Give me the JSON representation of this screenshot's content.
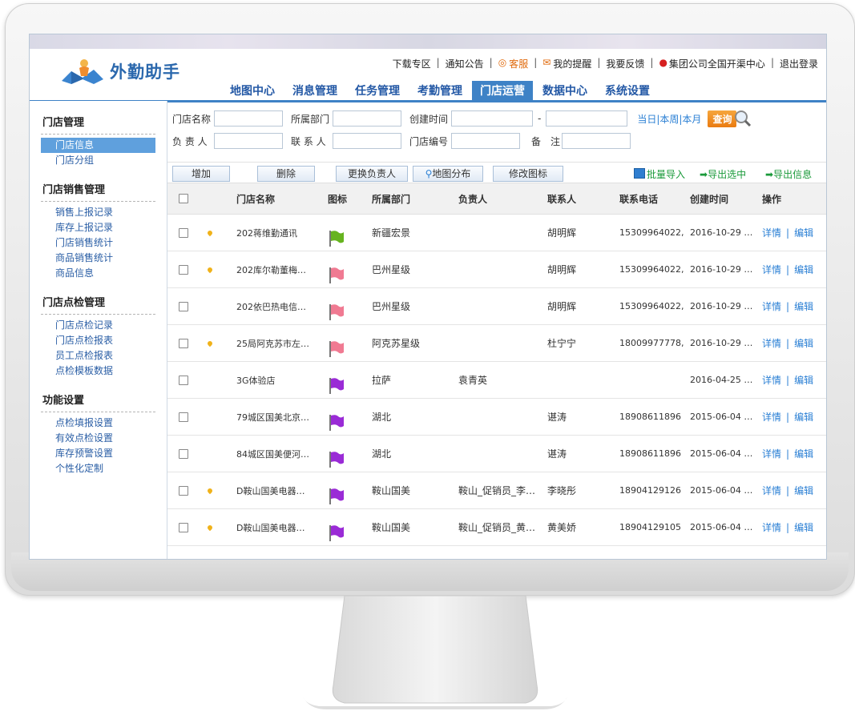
{
  "header": {
    "logo_text": "外勤助手",
    "top_links": [
      "下载专区",
      "通知公告",
      "客服",
      "我的提醒",
      "我要反馈",
      "集团公司全国开渠中心",
      "退出登录"
    ],
    "nav": [
      "地图中心",
      "消息管理",
      "任务管理",
      "考勤管理",
      "门店运营",
      "数据中心",
      "系统设置"
    ],
    "active_nav": "门店运营"
  },
  "sidebar": {
    "groups": [
      {
        "title": "门店管理",
        "items": [
          "门店信息",
          "门店分组"
        ]
      },
      {
        "title": "门店销售管理",
        "items": [
          "销售上报记录",
          "库存上报记录",
          "门店销售统计",
          "商品销售统计",
          "商品信息"
        ]
      },
      {
        "title": "门店点检管理",
        "items": [
          "门店点检记录",
          "门店点检报表",
          "员工点检报表",
          "点检模板数据"
        ]
      },
      {
        "title": "功能设置",
        "items": [
          "点检填报设置",
          "有效点检设置",
          "库存预警设置",
          "个性化定制"
        ]
      }
    ],
    "active_item": "门店信息"
  },
  "filters": {
    "store_name_label": "门店名称",
    "dept_label": "所属部门",
    "created_label": "创建时间",
    "dash": "-",
    "quick_range": "当日|本周|本月",
    "query_btn": "查询",
    "owner_label": "负 责 人",
    "contact_label": "联 系 人",
    "store_no_label": "门店编号",
    "remark_label": "备　注"
  },
  "toolbar": {
    "add": "增加",
    "delete": "删除",
    "change_owner": "更换负责人",
    "map_dist": "地图分布",
    "edit_icon": "修改图标",
    "batch_import": "批量导入",
    "export_selected": "导出选中",
    "export_info": "导出信息"
  },
  "table": {
    "headers": [
      "门店名称",
      "图标",
      "所属部门",
      "负责人",
      "联系人",
      "联系电话",
      "创建时间",
      "操作"
    ],
    "detail": "详情",
    "edit": "编辑",
    "rows": [
      {
        "pin": true,
        "name": "202蒋维勤通讯",
        "flag": "#66b31f",
        "dept": "新疆宏景",
        "owner": "",
        "contact": "胡明辉",
        "phone": "15309964022,",
        "created": "2016-10-29 …"
      },
      {
        "pin": true,
        "name": "202库尔勒董梅…",
        "flag": "#f07a92",
        "dept": "巴州星级",
        "owner": "",
        "contact": "胡明辉",
        "phone": "15309964022,",
        "created": "2016-10-29 …"
      },
      {
        "pin": false,
        "name": "202依巴热电信…",
        "flag": "#f07a92",
        "dept": "巴州星级",
        "owner": "",
        "contact": "胡明辉",
        "phone": "15309964022,",
        "created": "2016-10-29 …"
      },
      {
        "pin": true,
        "name": "25局阿克苏市左…",
        "flag": "#f07a92",
        "dept": "阿克苏星级",
        "owner": "",
        "contact": "杜宁宁",
        "phone": "18009977778,",
        "created": "2016-10-29 …"
      },
      {
        "pin": false,
        "name": "3G体验店",
        "flag": "#9a2bd6",
        "dept": "拉萨",
        "owner": "袁青英",
        "contact": "",
        "phone": "",
        "created": "2016-04-25 …"
      },
      {
        "pin": false,
        "name": "79城区国美北京…",
        "flag": "#9a2bd6",
        "dept": "湖北",
        "owner": "",
        "contact": "谌涛",
        "phone": "18908611896",
        "created": "2015-06-04 …"
      },
      {
        "pin": false,
        "name": "84城区国美便河…",
        "flag": "#9a2bd6",
        "dept": "湖北",
        "owner": "",
        "contact": "谌涛",
        "phone": "18908611896",
        "created": "2015-06-04 …"
      },
      {
        "pin": true,
        "name": "D鞍山国美电器…",
        "flag": "#9a2bd6",
        "dept": "鞍山国美",
        "owner": "鞍山_促销员_李…",
        "contact": "李晓彤",
        "phone": "18904129126",
        "created": "2015-06-04 …"
      },
      {
        "pin": true,
        "name": "D鞍山国美电器…",
        "flag": "#9a2bd6",
        "dept": "鞍山国美",
        "owner": "鞍山_促销员_黄…",
        "contact": "黄美娇",
        "phone": "18904129105",
        "created": "2015-06-04 …"
      }
    ]
  }
}
